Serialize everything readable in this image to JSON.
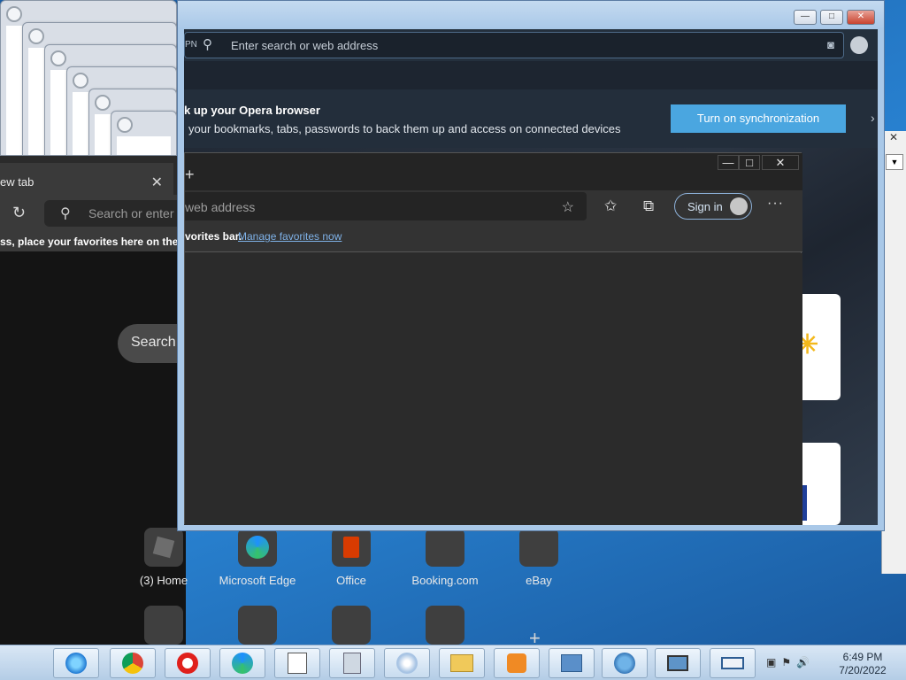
{
  "opera_main": {
    "search_placeholder": "Enter search or web address",
    "vpn_label": "PN",
    "sync_title": "k up your Opera browser",
    "sync_subtitle": "your bookmarks, tabs, passwords to back them up and access on connected devices",
    "sync_button": "Turn on synchronization"
  },
  "opera_back": {
    "tab_title": "ew tab",
    "search_placeholder": "Search or enter",
    "favorites_hint": "ss, place your favorites here on the fa",
    "search_pill": "Search"
  },
  "edge": {
    "address_placeholder": "web address",
    "favorites_hint_tail": "vorites bar.",
    "manage_favorites": "Manage favorites now",
    "sign_in": "Sign in",
    "more": "···"
  },
  "speed_dial": [
    {
      "label": "(3) Home"
    },
    {
      "label": "Microsoft Edge"
    },
    {
      "label": "Office"
    },
    {
      "label": "Booking.com"
    },
    {
      "label": "eBay"
    }
  ],
  "clock": {
    "time": "6:49 PM",
    "date": "7/20/2022"
  },
  "colors": {
    "sync_button": "#4aa6e0",
    "edge_link": "#7fb2e8",
    "taskbar": "#c8dcef"
  }
}
